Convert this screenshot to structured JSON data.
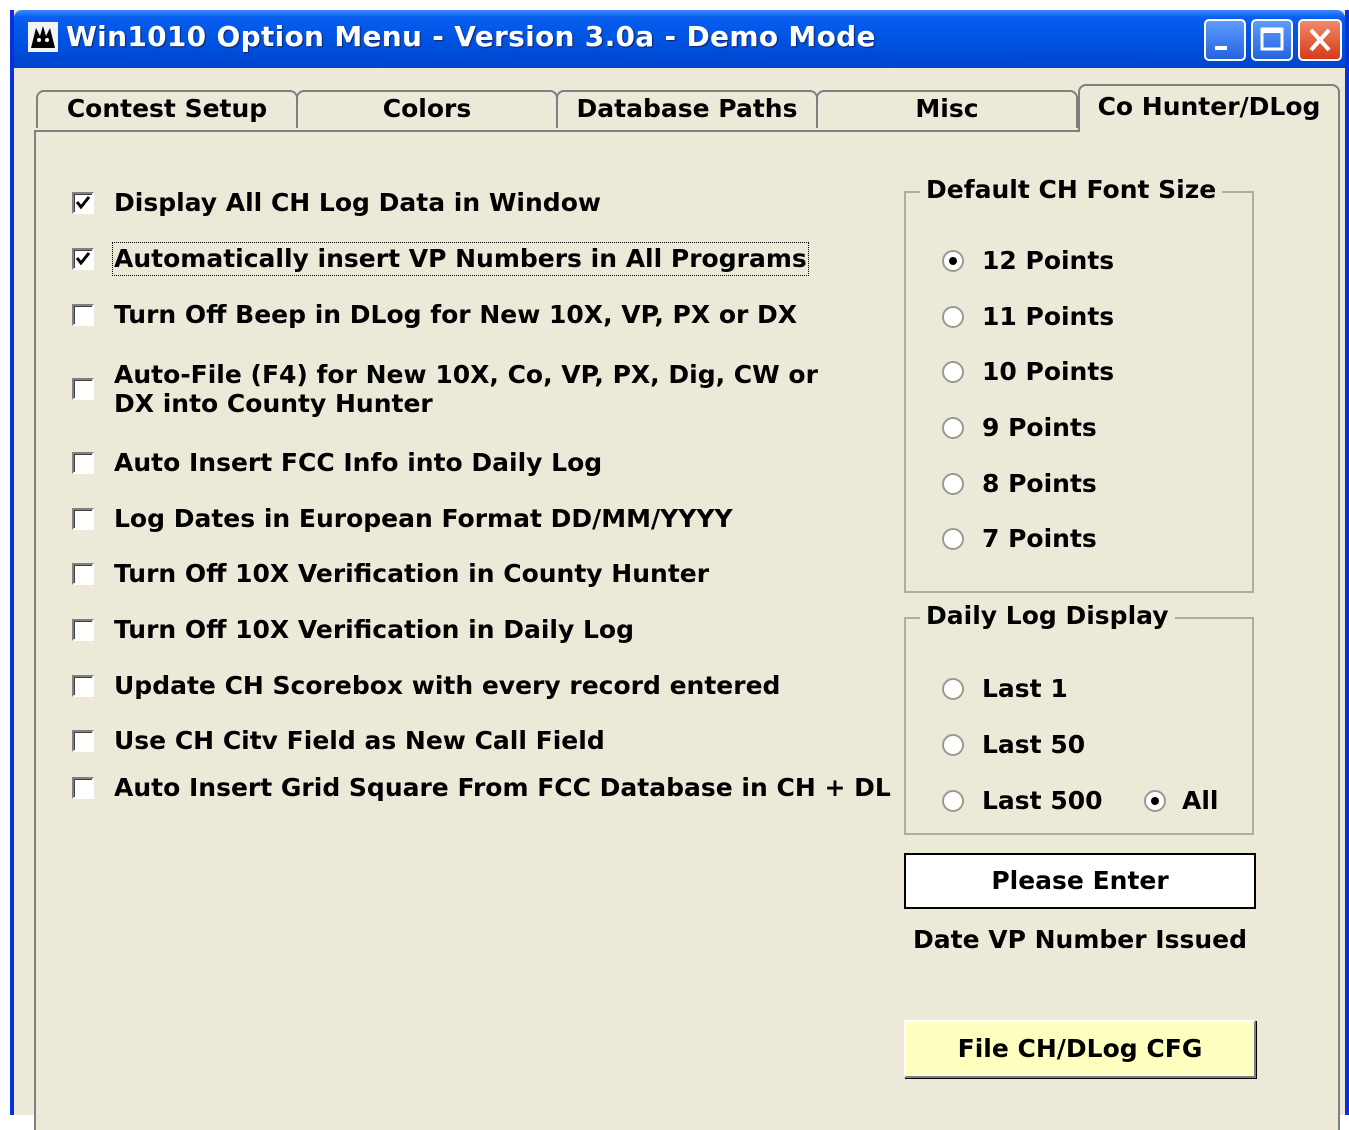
{
  "window": {
    "title": "Win1010 Option Menu - Version 3.0a  -  Demo Mode"
  },
  "tabs": [
    {
      "label": "Contest Setup"
    },
    {
      "label": "Colors"
    },
    {
      "label": "Database Paths"
    },
    {
      "label": "Misc"
    },
    {
      "label": "Co Hunter/DLog",
      "active": true
    }
  ],
  "options": [
    {
      "label": "Display All CH Log Data in Window",
      "checked": true
    },
    {
      "label": "Automatically insert VP Numbers in All Programs",
      "checked": true
    },
    {
      "label": "Turn Off Beep in DLog for New 10X, VP, PX or DX",
      "checked": false
    },
    {
      "label_line1": "Auto-File (F4) for New 10X, Co, VP, PX, Dig, CW or",
      "label_line2": "DX into County Hunter",
      "checked": false
    },
    {
      "label": "Auto Insert FCC Info into Daily Log",
      "checked": false
    },
    {
      "label": "Log Dates in European Format DD/MM/YYYY",
      "checked": false
    },
    {
      "label": "Turn Off 10X Verification in County Hunter",
      "checked": false
    },
    {
      "label": "Turn Off 10X Verification in Daily Log",
      "checked": false
    },
    {
      "label": "Update CH Scorebox with every record entered",
      "checked": false
    },
    {
      "label": "Use CH Citv Field as New Call Field",
      "checked": false
    },
    {
      "label": "Auto Insert Grid Square From FCC Database in CH + DL",
      "checked": false
    }
  ],
  "font_size_group": {
    "title": "Default CH Font Size",
    "options": [
      "12 Points",
      "11 Points",
      "10 Points",
      "9 Points",
      "8 Points",
      "7 Points"
    ],
    "selected": "12 Points"
  },
  "daily_log_group": {
    "title": "Daily Log Display",
    "options": [
      "Last 1",
      "Last 50",
      "Last 500",
      "All"
    ],
    "selected": "All"
  },
  "vp_date": {
    "value": "Please Enter",
    "caption": "Date VP Number Issued"
  },
  "file_button": {
    "label": "File CH/DLog CFG"
  },
  "colors": {
    "titlebar": "#0054e3",
    "dialog_bg": "#ece9d8",
    "file_button_bg": "#ffffc0",
    "close_button": "#d63a1a"
  }
}
